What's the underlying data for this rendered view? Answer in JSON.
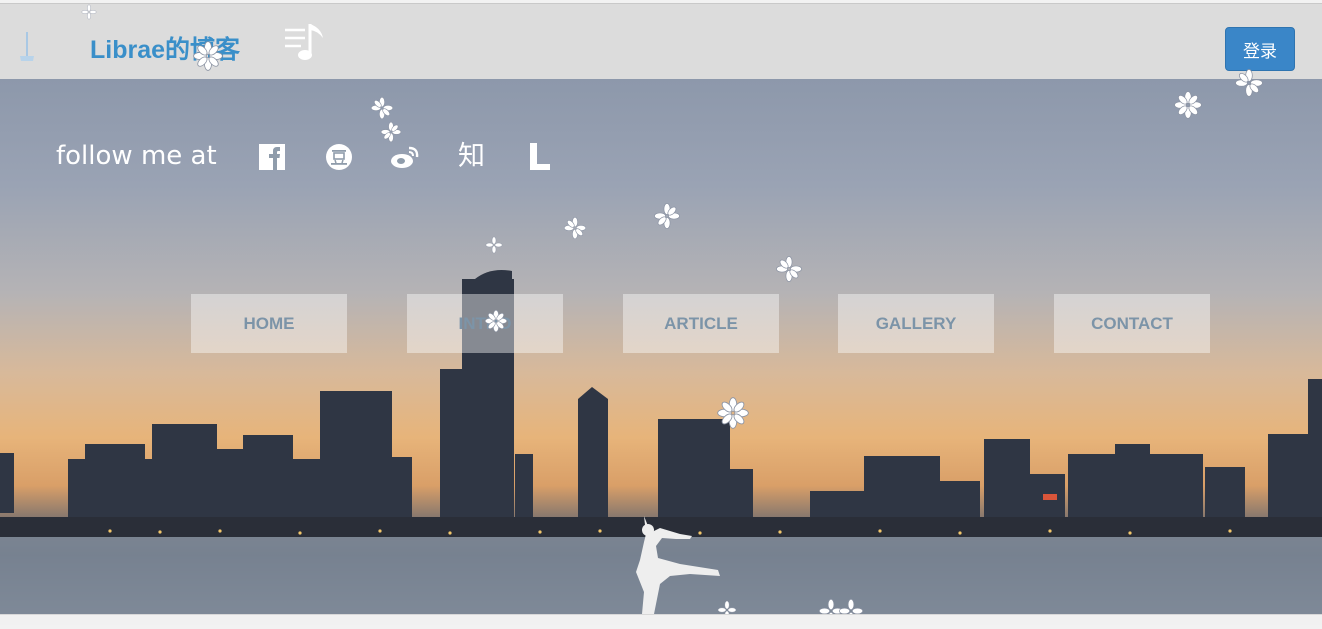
{
  "header": {
    "title": "Librae的博客",
    "login_label": "登录",
    "broom_icon": "broom-icon",
    "music_icon": "music-note-icon"
  },
  "hero": {
    "follow_text": "follow me at",
    "social": [
      {
        "name": "facebook",
        "icon": "facebook-icon"
      },
      {
        "name": "douban",
        "icon": "douban-icon"
      },
      {
        "name": "weibo",
        "icon": "weibo-icon"
      },
      {
        "name": "zhihu",
        "icon": "zhihu-icon",
        "glyph": "知"
      },
      {
        "name": "lofter",
        "icon": "lofter-icon",
        "glyph": "L"
      }
    ],
    "nav": [
      {
        "label": "HOME"
      },
      {
        "label": "INTRO"
      },
      {
        "label": "ARTICLE"
      },
      {
        "label": "GALLERY"
      },
      {
        "label": "CONTACT"
      }
    ]
  },
  "colors": {
    "title": "#3a8fc9",
    "login_bg": "#3a86c8",
    "header_bg": "#dcdcdc",
    "nav_text": "#7c94a8"
  },
  "statusbar": {
    "text": ""
  }
}
